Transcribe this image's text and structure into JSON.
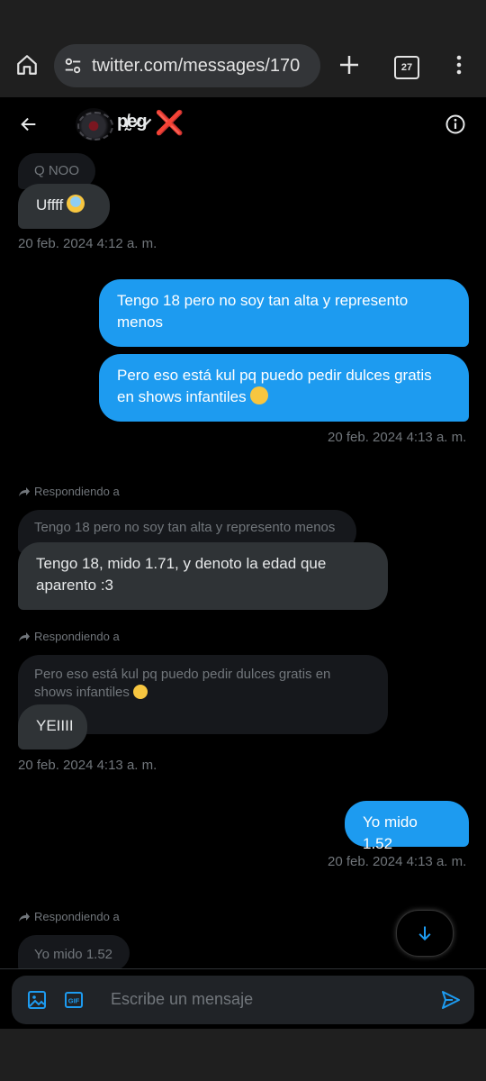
{
  "browser": {
    "url": "twitter.com/messages/170",
    "tab_count": "27"
  },
  "conversation": {
    "name_glyphs": "p̸̰e̷g̷",
    "name_suffix": "❌"
  },
  "messages": {
    "m1_quote": "Q NOO",
    "m1_text": "Uffff",
    "m1_emoji": "anxious-face-emoji",
    "ts1": "20 feb. 2024 4:12 a. m.",
    "m2_text": "Tengo 18 pero no soy tan alta y represento menos",
    "m3_text": "Pero eso está kul pq puedo pedir dulces gratis en shows infantiles",
    "m3_emoji": "smirking-cat-emoji",
    "ts2": "20 feb. 2024 4:13 a. m.",
    "reply_label": "Respondiendo a",
    "m4_quote": "Tengo 18 pero no soy tan alta y represento menos",
    "m4_text": "Tengo 18, mido 1.71, y denoto la edad que aparento :3",
    "m5_quote": "Pero eso está kul pq puedo pedir dulces gratis en shows infantiles",
    "m5_text": "YEIIII",
    "ts3": "20 feb. 2024 4:13 a. m.",
    "m6_text": "Yo mido 1.52",
    "ts4": "20 feb. 2024 4:13 a. m.",
    "m7_quote": "Yo mido 1.52"
  },
  "composer": {
    "placeholder": "Escribe un mensaje"
  },
  "colors": {
    "accent": "#1d9bf0",
    "received_bubble": "#2f3336",
    "muted_text": "#71767b"
  }
}
